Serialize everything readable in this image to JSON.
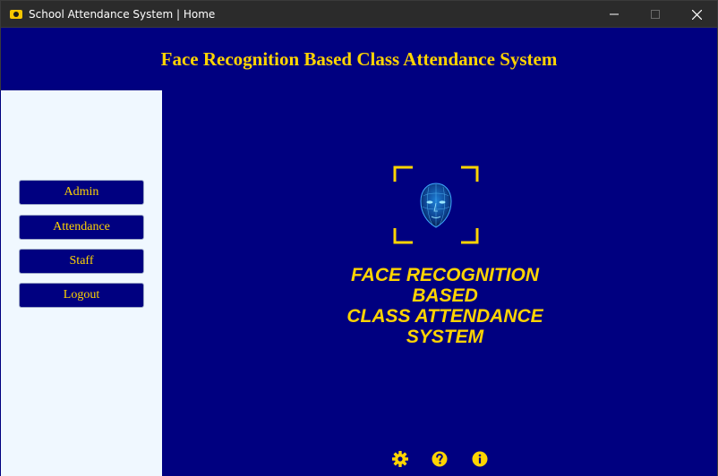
{
  "window": {
    "title": "School Attendance System | Home",
    "controls": {
      "minimize": "—",
      "maximize": "☐",
      "close": "✕"
    }
  },
  "header": {
    "title": "Face Recognition Based Class Attendance System"
  },
  "sidebar": {
    "items": [
      {
        "label": "Admin"
      },
      {
        "label": "Attendance"
      },
      {
        "label": "Staff"
      },
      {
        "label": "Logout"
      }
    ]
  },
  "main": {
    "logo": {
      "icon": "face-scan-icon",
      "lines": [
        "FACE RECOGNITION",
        "BASED",
        "CLASS ATTENDANCE",
        "SYSTEM"
      ]
    },
    "footer_icons": [
      "settings-gear-icon",
      "help-question-icon",
      "info-icon"
    ]
  },
  "colors": {
    "background": "#000080",
    "accent": "#ffd400",
    "sidebar": "#f0f8ff",
    "titlebar": "#2b2b2b"
  }
}
